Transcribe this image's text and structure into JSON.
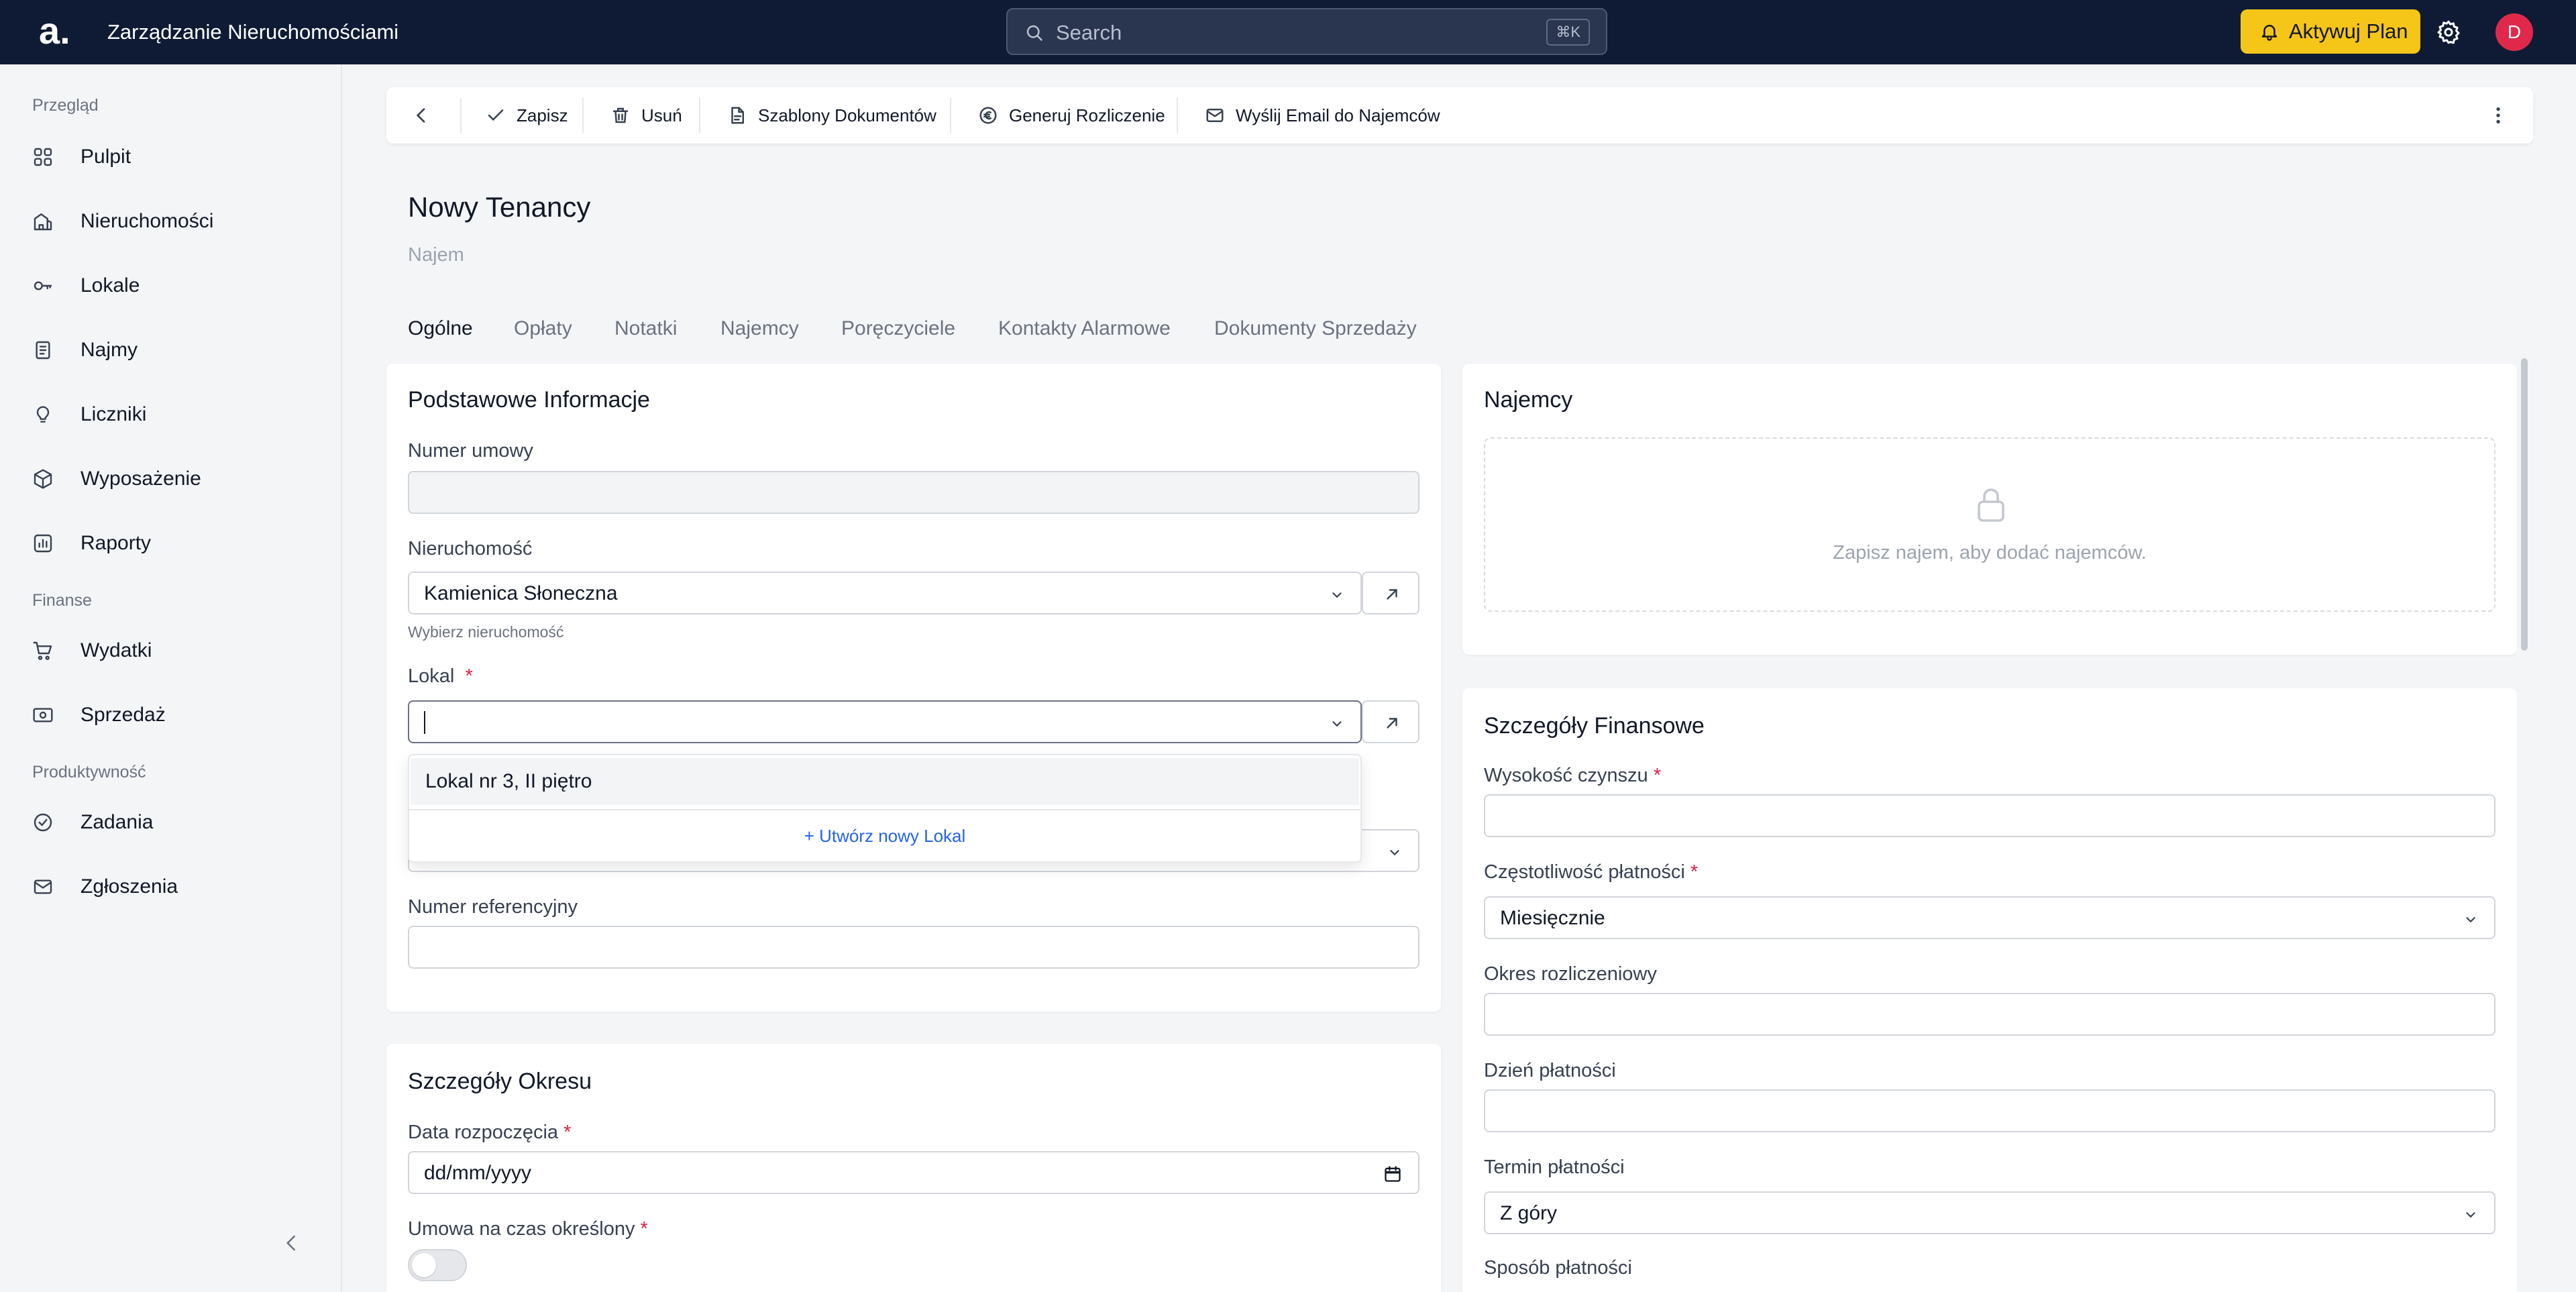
{
  "header": {
    "logo": "a.",
    "app_title": "Zarządzanie Nieruchomościami",
    "search_placeholder": "Search",
    "search_shortcut": "⌘K",
    "upgrade_label": "Aktywuj Plan",
    "avatar_initial": "D"
  },
  "sidebar": {
    "sections": [
      {
        "label": "Przegląd",
        "items": [
          {
            "label": "Pulpit",
            "icon": "dashboard-icon"
          },
          {
            "label": "Nieruchomości",
            "icon": "building-icon"
          },
          {
            "label": "Lokale",
            "icon": "key-icon"
          },
          {
            "label": "Najmy",
            "icon": "document-icon"
          },
          {
            "label": "Liczniki",
            "icon": "bulb-icon"
          },
          {
            "label": "Wyposażenie",
            "icon": "box-icon"
          },
          {
            "label": "Raporty",
            "icon": "chart-icon"
          }
        ]
      },
      {
        "label": "Finanse",
        "items": [
          {
            "label": "Wydatki",
            "icon": "cart-icon"
          },
          {
            "label": "Sprzedaż",
            "icon": "cash-icon"
          }
        ]
      },
      {
        "label": "Produktywność",
        "items": [
          {
            "label": "Zadania",
            "icon": "check-circle-icon"
          },
          {
            "label": "Zgłoszenia",
            "icon": "mail-icon"
          }
        ]
      }
    ]
  },
  "toolbar": {
    "save": "Zapisz",
    "delete": "Usuń",
    "templates": "Szablony Dokumentów",
    "settlement": "Generuj Rozliczenie",
    "email": "Wyślij Email do Najemców"
  },
  "page": {
    "title": "Nowy Tenancy",
    "subtitle": "Najem"
  },
  "tabs": [
    "Ogólne",
    "Opłaty",
    "Notatki",
    "Najemcy",
    "Poręczyciele",
    "Kontakty Alarmowe",
    "Dokumenty Sprzedaży"
  ],
  "basic_info": {
    "title": "Podstawowe Informacje",
    "contract_number_label": "Numer umowy",
    "contract_number_value": "",
    "property_label": "Nieruchomość",
    "property_value": "Kamienica Słoneczna",
    "property_help": "Wybierz nieruchomość",
    "unit_label": "Lokal",
    "unit_value": "",
    "unit_options": [
      "Lokal nr 3, II piętro"
    ],
    "create_unit": "+ Utwórz nowy Lokal",
    "reference_label": "Numer referencyjny",
    "reference_value": ""
  },
  "period": {
    "title": "Szczegóły Okresu",
    "start_date_label": "Data rozpoczęcia",
    "start_date_placeholder": "dd/mm/yyyy",
    "fixed_term_label": "Umowa na czas określony",
    "fixed_term_on": false
  },
  "tenants_panel": {
    "title": "Najemcy",
    "empty_message": "Zapisz najem, aby dodać najemców."
  },
  "finance": {
    "title": "Szczegóły Finansowe",
    "rent_label": "Wysokość czynszu",
    "rent_value": "",
    "frequency_label": "Częstotliwość płatności",
    "frequency_value": "Miesięcznie",
    "billing_period_label": "Okres rozliczeniowy",
    "billing_period_value": "",
    "payment_day_label": "Dzień płatności",
    "payment_day_value": "",
    "payment_term_label": "Termin płatności",
    "payment_term_value": "Z góry",
    "payment_method_label": "Sposób płatności"
  },
  "colors": {
    "header_bg": "#0f1b35",
    "accent_yellow": "#f5c518",
    "avatar_red": "#e0294a",
    "link_blue": "#2563eb",
    "required_red": "#e11d48"
  }
}
